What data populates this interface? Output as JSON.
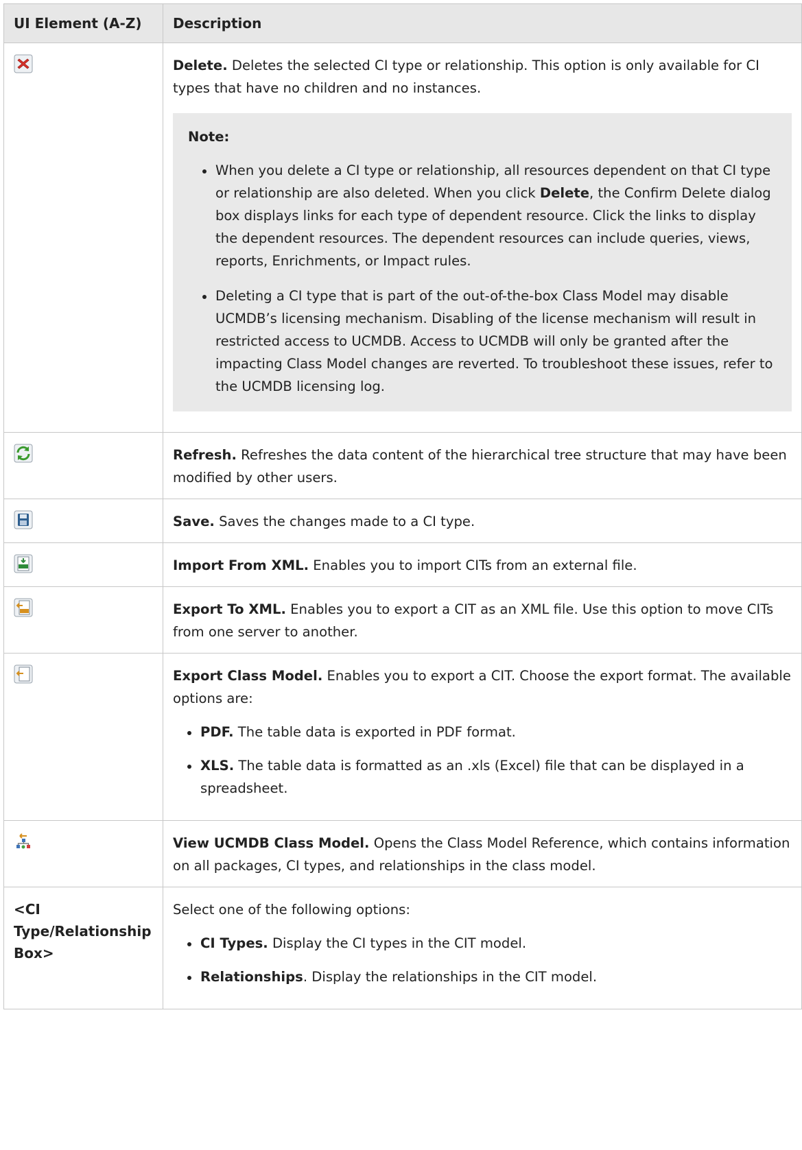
{
  "table": {
    "headers": [
      "UI Element (A-Z)",
      "Description"
    ],
    "rows": [
      {
        "icon": "delete-icon",
        "title": "Delete.",
        "text": " Deletes the selected CI type or relationship. This option is only available for CI types that have no children and no instances.",
        "note": {
          "title": "Note:",
          "items": [
            {
              "before": "When you delete a CI type or relationship, all resources dependent on that CI type or relationship are also deleted. When you click ",
              "bold": "Delete",
              "after": ", the Confirm Delete dialog box displays links for each type of dependent resource. Click the links to display the dependent resources. The dependent resources can include queries, views, reports, Enrichments, or Impact rules."
            },
            {
              "text": "Deleting a CI type that is part of the out-of-the-box Class Model may disable UCMDB’s licensing mechanism. Disabling of the license mechanism will result in restricted access to UCMDB. Access to UCMDB will only be granted after the impacting Class Model changes are reverted. To troubleshoot these issues, refer to the UCMDB licensing log."
            }
          ]
        }
      },
      {
        "icon": "refresh-icon",
        "title": "Refresh.",
        "text": " Refreshes the data content of the hierarchical tree structure that may have been modified by other users."
      },
      {
        "icon": "save-icon",
        "title": "Save.",
        "text": " Saves the changes made to a CI type."
      },
      {
        "icon": "import-xml-icon",
        "title": "Import From XML.",
        "text": " Enables you to import CITs from an external file."
      },
      {
        "icon": "export-xml-icon",
        "title": "Export To XML.",
        "text": " Enables you to export a CIT as an XML file. Use this option to move CITs from one server to another."
      },
      {
        "icon": "export-class-model-icon",
        "title": "Export Class Model.",
        "text": " Enables you to export a CIT. Choose the export format. The available options are:",
        "items": [
          {
            "bold": "PDF.",
            "text": " The table data is exported in PDF format."
          },
          {
            "bold": "XLS.",
            "text": " The table data is formatted as an .xls (Excel) file that can be displayed in a spreadsheet."
          }
        ]
      },
      {
        "icon": "view-class-model-icon",
        "title": "View UCMDB Class Model.",
        "text": " Opens the Class Model Reference, which contains information on all packages, CI types, and relationships in the class model."
      },
      {
        "element": "<CI Type/Relationship Box>",
        "text": "Select one of the following options:",
        "items": [
          {
            "bold": "CI Types.",
            "text": " Display the CI types in the CIT model."
          },
          {
            "bold": "Relationships",
            "text": ". Display the relationships in the CIT model."
          }
        ]
      }
    ]
  }
}
